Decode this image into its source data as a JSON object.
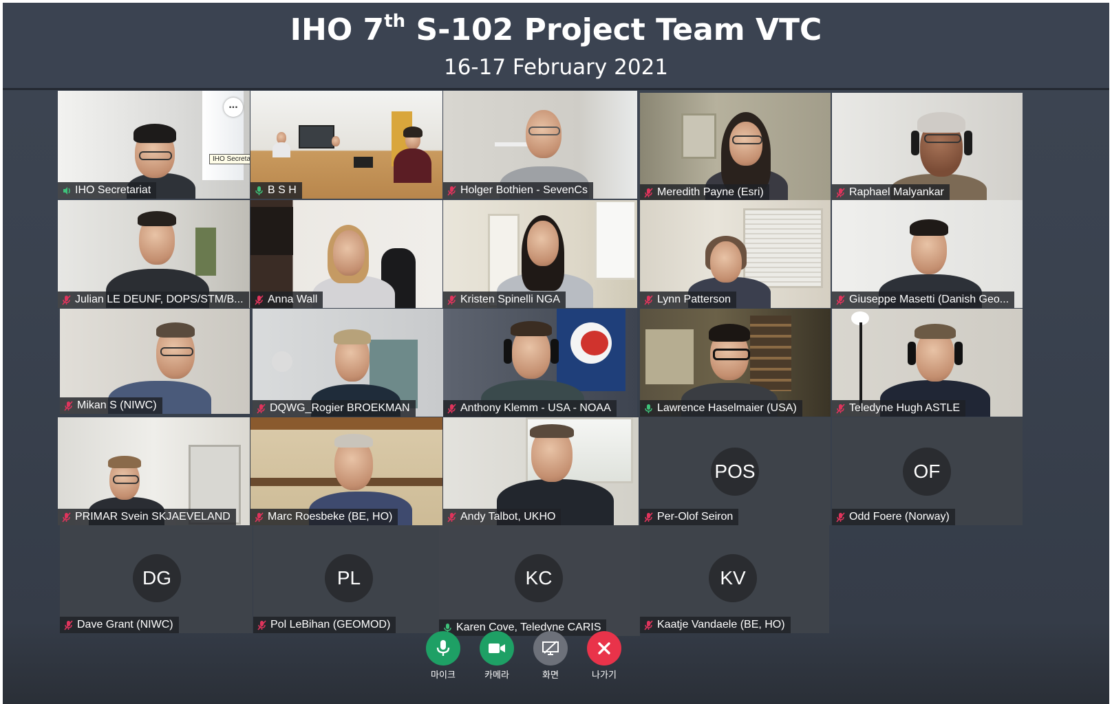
{
  "header": {
    "title_pre": "IHO 7",
    "title_sup": "th",
    "title_post": " S-102 Project Team VTC",
    "date": "16-17 February 2021"
  },
  "colors": {
    "mic_muted": "#e0345c",
    "mic_active": "#3ec27a",
    "btn_mic": "#1ea065",
    "btn_camera": "#1ea065",
    "btn_screen": "#6d717a",
    "btn_leave": "#e9334a"
  },
  "tiles": {
    "iho": {
      "name": "IHO Secretariat",
      "mic": "speaking",
      "tooltip": "IHO Secretariat",
      "more_icon": "..."
    },
    "bsh": {
      "name": "B S H",
      "mic": "on"
    },
    "holger": {
      "name": "Holger Bothien - SevenCs",
      "mic": "muted"
    },
    "meredith": {
      "name": "Meredith Payne (Esri)",
      "mic": "muted"
    },
    "raphael": {
      "name": "Raphael Malyankar",
      "mic": "muted"
    },
    "julian": {
      "name": "Julian LE DEUNF, DOPS/STM/B...",
      "mic": "muted"
    },
    "anna": {
      "name": "Anna Wall",
      "mic": "muted"
    },
    "kristen": {
      "name": "Kristen Spinelli NGA",
      "mic": "muted"
    },
    "lynn": {
      "name": "Lynn Patterson",
      "mic": "muted"
    },
    "giuseppe": {
      "name": "Giuseppe Masetti (Danish Geo...",
      "mic": "muted"
    },
    "mikan": {
      "name": "Mikan S (NIWC)",
      "mic": "muted"
    },
    "rogier": {
      "name": "DQWG_Rogier BROEKMAN",
      "mic": "muted"
    },
    "anthony": {
      "name": "Anthony Klemm - USA - NOAA",
      "mic": "muted"
    },
    "lawrence": {
      "name": "Lawrence Haselmaier (USA)",
      "mic": "on"
    },
    "hugh": {
      "name": "Teledyne Hugh ASTLE",
      "mic": "muted"
    },
    "svein": {
      "name": "PRIMAR Svein SKJAEVELAND",
      "mic": "muted"
    },
    "marc": {
      "name": "Marc Roesbeke (BE, HO)",
      "mic": "muted"
    },
    "andy": {
      "name": "Andy Talbot, UKHO",
      "mic": "muted"
    },
    "perolof": {
      "name": "Per-Olof Seiron",
      "initials": "POS",
      "mic": "muted"
    },
    "odd": {
      "name": "Odd Foere (Norway)",
      "initials": "OF",
      "mic": "muted"
    },
    "dave": {
      "name": "Dave Grant (NIWC)",
      "initials": "DG",
      "mic": "muted"
    },
    "pol": {
      "name": "Pol LeBihan (GEOMOD)",
      "initials": "PL",
      "mic": "muted"
    },
    "karen": {
      "name": "Karen Cove, Teledyne CARIS",
      "initials": "KC",
      "mic": "on"
    },
    "kaatje": {
      "name": "Kaatje Vandaele (BE, HO)",
      "initials": "KV",
      "mic": "muted"
    }
  },
  "controls": {
    "mic": {
      "label": "마이크",
      "icon": "microphone-icon"
    },
    "camera": {
      "label": "카메라",
      "icon": "video-camera-icon"
    },
    "screen": {
      "label": "화면",
      "icon": "screen-share-icon"
    },
    "leave": {
      "label": "나가기",
      "icon": "close-icon"
    }
  }
}
